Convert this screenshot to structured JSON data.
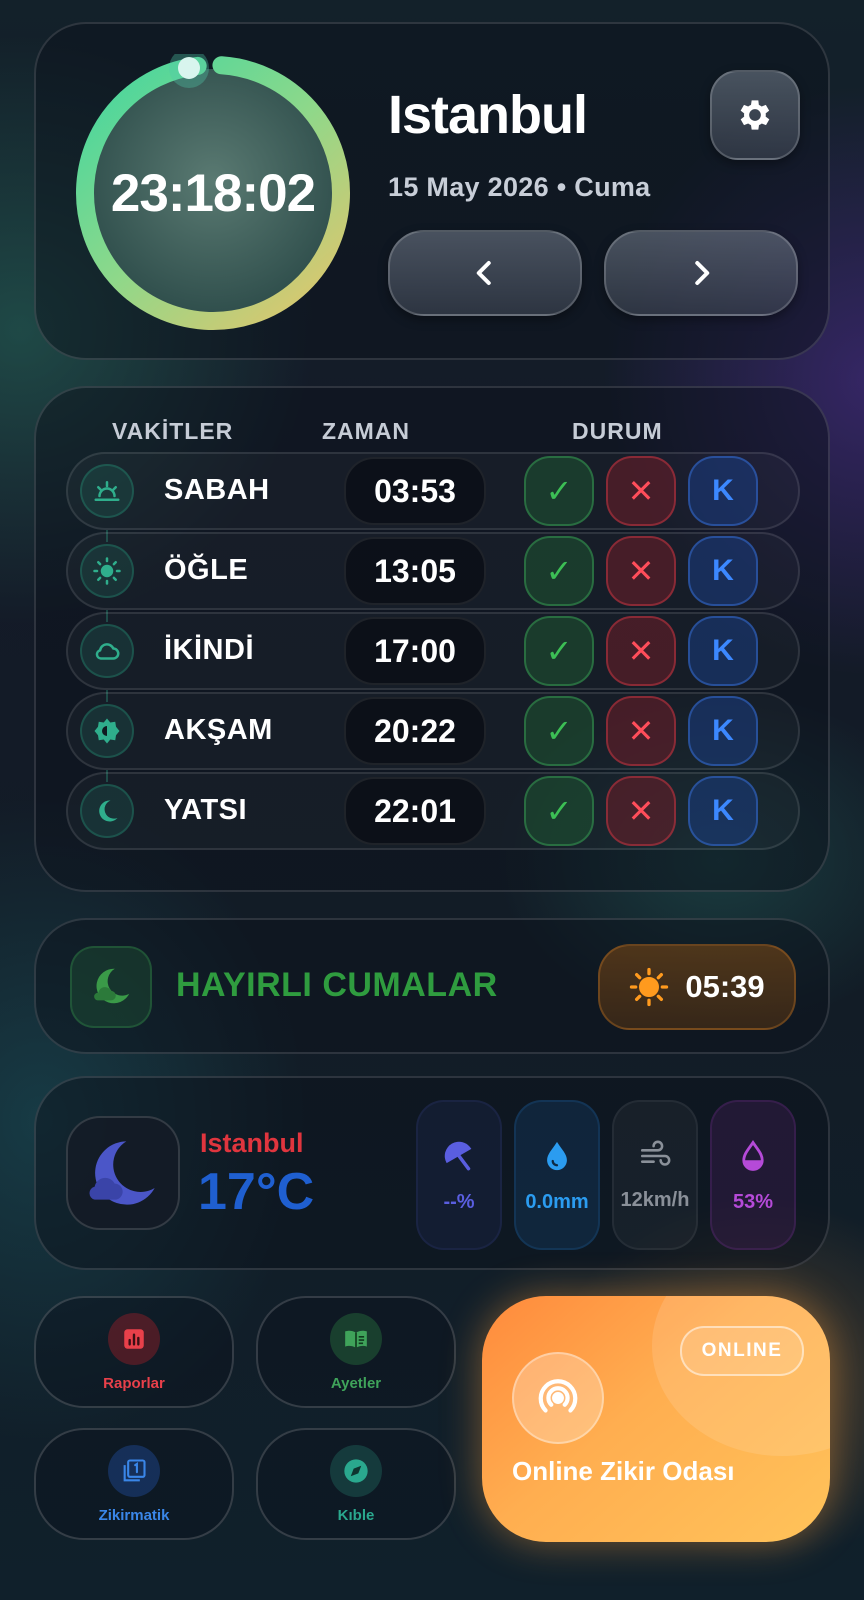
{
  "header": {
    "clock": "23:18:02",
    "city": "Istanbul",
    "date": "15 May 2026 • Cuma",
    "ring_progress": 0.97,
    "icons": {
      "settings": "gear-icon",
      "prev": "chevron-left-icon",
      "next": "chevron-right-icon"
    }
  },
  "prayers": {
    "headers": {
      "name": "VAKİTLER",
      "time": "ZAMAN",
      "status": "DURUM"
    },
    "rows": [
      {
        "name": "SABAH",
        "time": "03:53",
        "icon": "sunrise-icon"
      },
      {
        "name": "ÖĞLE",
        "time": "13:05",
        "icon": "sun-icon"
      },
      {
        "name": "İKİNDİ",
        "time": "17:00",
        "icon": "cloud-icon"
      },
      {
        "name": "AKŞAM",
        "time": "20:22",
        "icon": "sunset-icon"
      },
      {
        "name": "YATSI",
        "time": "22:01",
        "icon": "moon-icon"
      }
    ],
    "status_labels": {
      "done": "✓",
      "missed": "✕",
      "kaza": "K"
    }
  },
  "cuma": {
    "message": "HAYIRLI CUMALAR",
    "sun_time": "05:39",
    "colors": {
      "message": "#2f9c3f",
      "pill": "#ff9a2e"
    }
  },
  "weather": {
    "city": "Istanbul",
    "temp": "17°C",
    "stats": [
      {
        "icon": "umbrella-icon",
        "value": "--%",
        "color": "#5a5ee0"
      },
      {
        "icon": "water-drop-icon",
        "value": "0.0mm",
        "color": "#2b9cf0"
      },
      {
        "icon": "wind-icon",
        "value": "12km/h",
        "color": "#8a9099"
      },
      {
        "icon": "humidity-icon",
        "value": "53%",
        "color": "#b54ad8"
      }
    ]
  },
  "tiles": [
    {
      "label": "Raporlar",
      "icon": "chart-icon",
      "color": "#e8404a"
    },
    {
      "label": "Ayetler",
      "icon": "book-icon",
      "color": "#3fa35a"
    },
    {
      "label": "Zikirmatik",
      "icon": "counter-icon",
      "color": "#3a86e8"
    },
    {
      "label": "Kıble",
      "icon": "compass-icon",
      "color": "#2aa88e"
    }
  ],
  "zikir": {
    "badge": "ONLINE",
    "title": "Online Zikir Odası",
    "icon": "broadcast-icon"
  }
}
